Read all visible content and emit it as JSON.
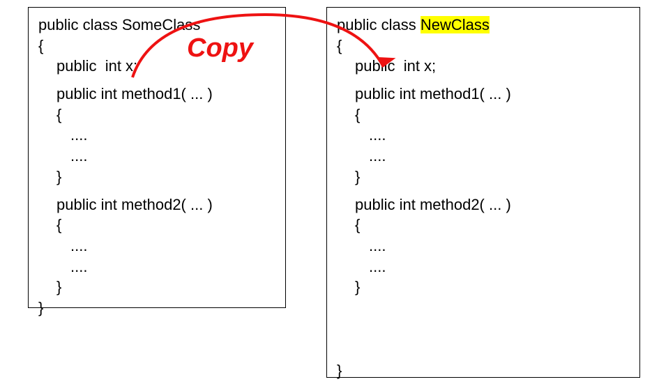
{
  "diagram": {
    "copy_label": "Copy",
    "left_box": {
      "decl_prefix": "public class ",
      "class_name": "SomeClass",
      "open_brace": "{",
      "field": "public  int x;",
      "method1_sig": "public int method1( ... )",
      "m1_open": "{",
      "m1_body1": "....",
      "m1_body2": "....",
      "m1_close": "}",
      "method2_sig": "public int method2( ... )",
      "m2_open": "{",
      "m2_body1": "....",
      "m2_body2": "....",
      "m2_close": "}",
      "close_brace": "}"
    },
    "right_box": {
      "decl_prefix": "public class ",
      "class_name": "NewClass",
      "open_brace": "{",
      "field": "public  int x;",
      "method1_sig": "public int method1( ... )",
      "m1_open": "{",
      "m1_body1": "....",
      "m1_body2": "....",
      "m1_close": "}",
      "method2_sig": "public int method2( ... )",
      "m2_open": "{",
      "m2_body1": "....",
      "m2_body2": "....",
      "m2_close": "}",
      "close_brace": "}"
    }
  }
}
